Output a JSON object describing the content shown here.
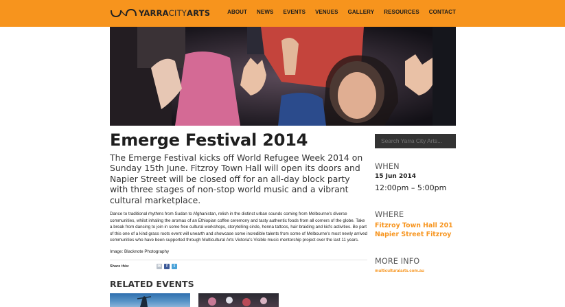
{
  "header": {
    "brand": {
      "bold1": "YARRA",
      "mid": "CITY",
      "bold2": "ARTS"
    },
    "nav": [
      "ABOUT",
      "NEWS",
      "EVENTS",
      "VENUES",
      "GALLERY",
      "RESOURCES",
      "CONTACT"
    ],
    "colors": {
      "brand_orange": "#f7941d",
      "dark": "#333333"
    }
  },
  "hero": {
    "description_icon": "photo"
  },
  "article": {
    "title": "Emerge Festival 2014",
    "lead": "The Emerge Festival kicks off World Refugee Week 2014 on Sunday 15th June. Fitzroy Town Hall will open its doors and Napier Street will be closed off for an all-day block party with three stages of non-stop world music and a vibrant cultural marketplace.",
    "body": "Dance to traditional rhythms from Sudan to Afghanistan, relish in the distinct urban sounds coming from Melbourne's diverse communities, whilst inhaling the aromas of an Ethiopian coffee ceremony and tasty authentic foods from all corners of the globe. Take a break from dancing to join in some free cultural workshops, storytelling circle, henna tattoos, hair braiding and kid's activities. Be part of this one of a kind grass roots event will unearth and showcase some incredible talents from some of Melbourne's most newly arrived communities who have been supported through Multicultural Arts Victoria's Visible music mentorship project over the last 11 years.",
    "credit": "Image: Blacknote Photography",
    "share_label": "Share this:",
    "share_icons": [
      "email-icon",
      "facebook-icon",
      "twitter-icon"
    ]
  },
  "related": {
    "title": "RELATED EVENTS"
  },
  "sidebar": {
    "search_placeholder": "Search Yarra City Arts...",
    "when_heading": "WHEN",
    "when_date": "15 Jun 2014",
    "when_time": "12:00pm – 5:00pm",
    "where_heading": "WHERE",
    "where_line1": "Fitzroy Town Hall 201",
    "where_line2": "Napier Street Fitzroy",
    "more_heading": "MORE INFO",
    "more_link": "multiculturalarts.com.au"
  }
}
